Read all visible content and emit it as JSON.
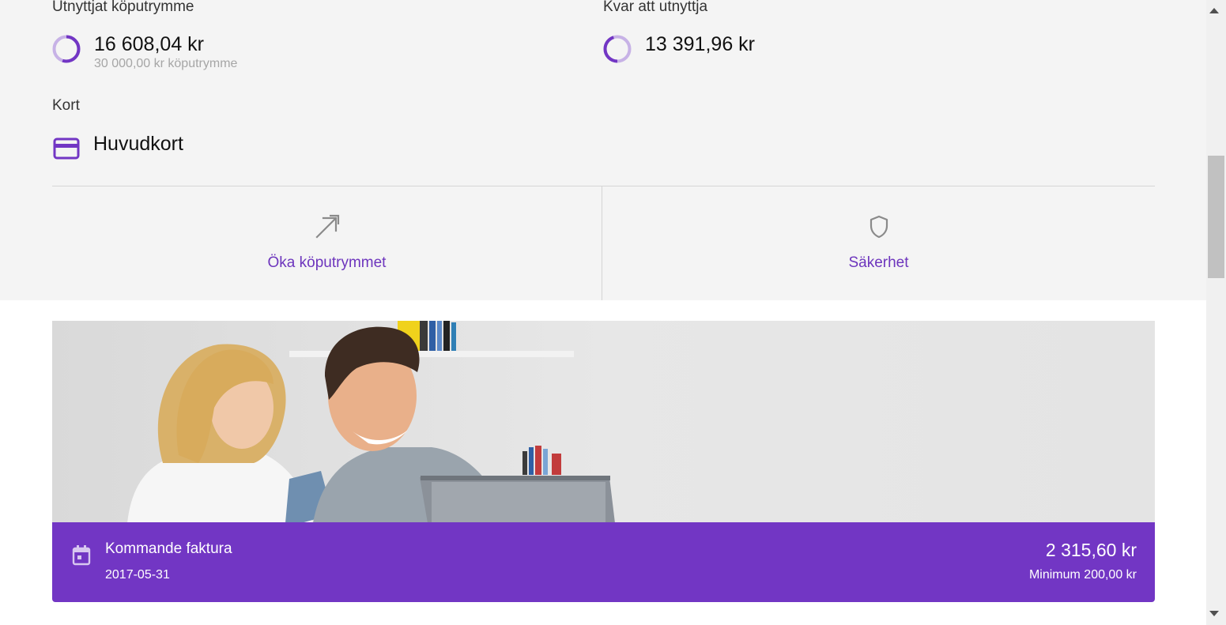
{
  "used_credit": {
    "label": "Utnyttjat köputrymme",
    "amount": "16 608,04 kr",
    "limit_text": "30 000,00 kr köputrymme",
    "ring_fraction": 0.55
  },
  "remaining_credit": {
    "label": "Kvar att utnyttja",
    "amount": "13 391,96 kr",
    "ring_fraction": 0.45
  },
  "card": {
    "label": "Kort",
    "name": "Huvudkort",
    "icon": "credit-card-icon"
  },
  "actions": [
    {
      "label": "Öka köputrymmet",
      "icon": "arrow-up-right-icon"
    },
    {
      "label": "Säkerhet",
      "icon": "shield-icon"
    }
  ],
  "invoice": {
    "title": "Kommande faktura",
    "date": "2017-05-31",
    "amount": "2 315,60 kr",
    "minimum": "Minimum 200,00 kr",
    "icon": "calendar-icon"
  },
  "colors": {
    "accent": "#7236c4",
    "accent_light": "#c7b2e6",
    "background": "#f4f4f4"
  }
}
